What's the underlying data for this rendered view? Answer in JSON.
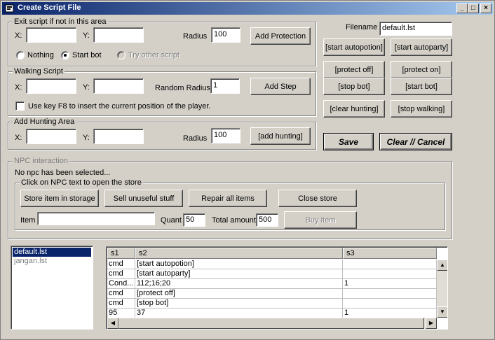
{
  "window": {
    "title": "Create Script File",
    "min": "_",
    "max": "□",
    "close": "×"
  },
  "exit_group": {
    "title": "Exit script if not in this area",
    "x_label": "X:",
    "x_value": "",
    "y_label": "Y:",
    "y_value": "",
    "radius_label": "Radius",
    "radius_value": "100",
    "add_button": "Add Protection",
    "radio_nothing": "Nothing",
    "radio_start": "Start bot",
    "radio_other": "Try other script",
    "selected": "Start bot"
  },
  "walk_group": {
    "title": "Walking Script",
    "x_label": "X:",
    "x_value": "",
    "y_label": "Y:",
    "y_value": "",
    "radius_label": "Random Radius",
    "radius_value": "1",
    "add_button": "Add Step",
    "checkbox_label": "Use key F8 to insert the current position of the player.",
    "checked": false
  },
  "hunt_group": {
    "title": "Add Hunting Area",
    "x_label": "X:",
    "x_value": "",
    "y_label": "Y:",
    "y_value": "",
    "radius_label": "Radius",
    "radius_value": "100",
    "add_button": "[add hunting]"
  },
  "right_panel": {
    "filename_label": "Filename",
    "filename_value": "default.lst",
    "buttons": [
      "[start autopotion]",
      "[start autoparty]",
      "[protect off]",
      "[protect on]",
      "[stop bot]",
      "[start bot]",
      "[clear hunting]",
      "[stop walking]"
    ],
    "save": "Save",
    "clear_cancel": "Clear // Cancel"
  },
  "npc_group": {
    "title": "NPC interaction",
    "status": "No npc has been selected...",
    "store_title": "Click on NPC text to open the store",
    "store_buttons": [
      "Store item in storage",
      "Sell unuseful stuff",
      "Repair all items",
      "Close store"
    ],
    "item_label": "Item",
    "item_value": "",
    "quant_label": "Quant",
    "quant_value": "50",
    "total_label": "Total amount",
    "total_value": "500",
    "buy_button": "Buy item"
  },
  "file_list": {
    "items": [
      "default.lst",
      "jangan.lst"
    ],
    "selected": 0
  },
  "script_grid": {
    "headers": [
      "s1",
      "s2",
      "s3"
    ],
    "rows": [
      [
        "cmd",
        "[start autopotion]",
        ""
      ],
      [
        "cmd",
        "[start autoparty]",
        ""
      ],
      [
        "Cond...",
        "112;16;20",
        "1"
      ],
      [
        "cmd",
        "[protect off]",
        ""
      ],
      [
        "cmd",
        "[stop bot]",
        ""
      ],
      [
        "95",
        "37",
        "1"
      ]
    ]
  },
  "colors": {
    "title_start": "#0a246a",
    "title_end": "#a6caf0",
    "face": "#d4d0c8",
    "selection": "#0a246a"
  }
}
